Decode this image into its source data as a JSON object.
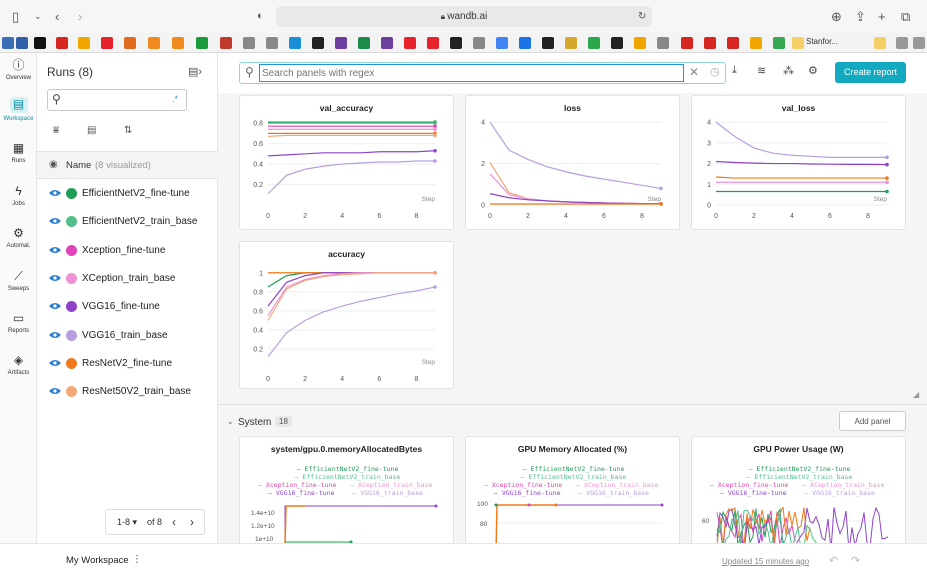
{
  "browser": {
    "url": "wandb.ai",
    "bookmark_label": "Stanfor..."
  },
  "rail": {
    "items": [
      {
        "label": "Overview",
        "icon": "info-icon"
      },
      {
        "label": "Workspace",
        "icon": "workspace-icon"
      },
      {
        "label": "Runs",
        "icon": "table-icon"
      },
      {
        "label": "Jobs",
        "icon": "lightning-icon"
      },
      {
        "label": "Automat.",
        "icon": "robot-icon"
      },
      {
        "label": "Sweeps",
        "icon": "broom-icon"
      },
      {
        "label": "Reports",
        "icon": "document-icon"
      },
      {
        "label": "Artifacts",
        "icon": "layers-icon"
      }
    ]
  },
  "runs_panel": {
    "title": "Runs (8)",
    "search_placeholder": "",
    "regex_symbol": ".*",
    "column_header": "Name",
    "column_header_sub": "(8 visualized)",
    "runs": [
      {
        "name": "EfficientNetV2_fine-tune",
        "color": "#1f9d55"
      },
      {
        "name": "EfficientNetV2_train_base",
        "color": "#52c08a"
      },
      {
        "name": "Xception_fine-tune",
        "color": "#e043b7"
      },
      {
        "name": "XCeption_train_base",
        "color": "#ef92d6"
      },
      {
        "name": "VGG16_fine-tune",
        "color": "#8e44c9"
      },
      {
        "name": "VGG16_train_base",
        "color": "#b79ee0"
      },
      {
        "name": "ResNetV2_fine-tune",
        "color": "#f07a1a"
      },
      {
        "name": "ResNet50V2_train_base",
        "color": "#f5a779"
      }
    ],
    "pager": {
      "range": "1-8",
      "of": "of 8"
    }
  },
  "toolbar": {
    "search_placeholder": "Search panels with regex",
    "create_report": "Create report"
  },
  "panels": {
    "val_accuracy": "val_accuracy",
    "loss": "loss",
    "val_loss": "val_loss",
    "accuracy": "accuracy",
    "step_label": "Step"
  },
  "system": {
    "label": "System",
    "count": "18",
    "add_panel": "Add panel",
    "panels": [
      {
        "title": "system/gpu.0.memoryAllocatedBytes",
        "ticks": [
          "1.4e+10",
          "1.2e+10",
          "1e+10"
        ]
      },
      {
        "title": "GPU Memory Allocated (%)",
        "ticks": [
          "100",
          "80"
        ]
      },
      {
        "title": "GPU Power Usage (W)",
        "ticks": [
          "60"
        ]
      }
    ],
    "legend": [
      "EfficientNetV2_fine-tune",
      "EfficientNetV2_train_base",
      "Xception_fine-tune",
      "XCeption_train_base",
      "VGG16_fine-tune",
      "VGG16_train_base"
    ]
  },
  "footer": {
    "workspace": "My Workspace",
    "updated": "Updated 15 minutes ago"
  },
  "chart_data": [
    {
      "type": "line",
      "title": "val_accuracy",
      "xlabel": "Step",
      "xlim": [
        0,
        9
      ],
      "ylim": [
        0,
        0.85
      ],
      "yticks": [
        0.8,
        0.6,
        0.4,
        0.2
      ],
      "xticks": [
        0,
        2,
        4,
        6,
        8
      ],
      "series": [
        {
          "name": "EfficientNetV2_fine-tune",
          "color": "#1f9d55",
          "x": [
            0,
            1,
            2,
            3,
            4,
            5,
            6,
            7,
            8,
            9
          ],
          "y": [
            0.81,
            0.81,
            0.81,
            0.81,
            0.81,
            0.81,
            0.81,
            0.81,
            0.81,
            0.81
          ]
        },
        {
          "name": "EfficientNetV2_train_base",
          "color": "#52c08a",
          "x": [
            0,
            1,
            2,
            3,
            4,
            5,
            6,
            7,
            8,
            9
          ],
          "y": [
            0.8,
            0.8,
            0.8,
            0.8,
            0.8,
            0.8,
            0.8,
            0.8,
            0.8,
            0.8
          ]
        },
        {
          "name": "Xception_fine-tune",
          "color": "#e043b7",
          "x": [
            0,
            1,
            2,
            3,
            4,
            5,
            6,
            7,
            8,
            9
          ],
          "y": [
            0.77,
            0.77,
            0.77,
            0.77,
            0.77,
            0.77,
            0.77,
            0.77,
            0.77,
            0.77
          ]
        },
        {
          "name": "XCeption_train_base",
          "color": "#ef92d6",
          "x": [
            0,
            1,
            2,
            3,
            4,
            5,
            6,
            7,
            8,
            9
          ],
          "y": [
            0.74,
            0.74,
            0.74,
            0.74,
            0.74,
            0.74,
            0.74,
            0.74,
            0.74,
            0.74
          ]
        },
        {
          "name": "ResNetV2_fine-tune",
          "color": "#f07a1a",
          "x": [
            0,
            1,
            2,
            3,
            4,
            5,
            6,
            7,
            8,
            9
          ],
          "y": [
            0.7,
            0.7,
            0.7,
            0.7,
            0.7,
            0.7,
            0.7,
            0.7,
            0.7,
            0.7
          ]
        },
        {
          "name": "ResNet50V2_train_base",
          "color": "#f5a779",
          "x": [
            0,
            1,
            2,
            3,
            4,
            5,
            6,
            7,
            8,
            9
          ],
          "y": [
            0.67,
            0.68,
            0.68,
            0.68,
            0.68,
            0.68,
            0.68,
            0.68,
            0.68,
            0.68
          ]
        },
        {
          "name": "VGG16_fine-tune",
          "color": "#8e44c9",
          "x": [
            0,
            1,
            2,
            3,
            4,
            5,
            6,
            7,
            8,
            9
          ],
          "y": [
            0.48,
            0.49,
            0.5,
            0.51,
            0.51,
            0.51,
            0.52,
            0.52,
            0.52,
            0.53
          ]
        },
        {
          "name": "VGG16_train_base",
          "color": "#b79ee0",
          "x": [
            0,
            1,
            2,
            3,
            4,
            5,
            6,
            7,
            8,
            9
          ],
          "y": [
            0.11,
            0.29,
            0.35,
            0.38,
            0.4,
            0.41,
            0.42,
            0.42,
            0.43,
            0.43
          ]
        }
      ]
    },
    {
      "type": "line",
      "title": "loss",
      "xlabel": "Step",
      "xlim": [
        0,
        9
      ],
      "ylim": [
        0,
        4.2
      ],
      "yticks": [
        4,
        2,
        0
      ],
      "xticks": [
        0,
        2,
        4,
        6,
        8
      ],
      "series": [
        {
          "name": "VGG16_train_base",
          "color": "#b79ee0",
          "x": [
            0,
            1,
            2,
            3,
            4,
            5,
            6,
            7,
            8,
            9
          ],
          "y": [
            4.0,
            2.65,
            2.2,
            1.85,
            1.6,
            1.4,
            1.25,
            1.1,
            0.95,
            0.8
          ]
        },
        {
          "name": "ResNet50V2_train_base",
          "color": "#f5a779",
          "x": [
            0,
            1,
            2,
            3,
            4,
            5,
            6,
            7,
            8,
            9
          ],
          "y": [
            2.05,
            0.6,
            0.3,
            0.2,
            0.15,
            0.12,
            0.1,
            0.08,
            0.07,
            0.06
          ]
        },
        {
          "name": "XCeption_train_base",
          "color": "#ef92d6",
          "x": [
            0,
            1,
            2,
            3,
            4,
            5,
            6,
            7,
            8,
            9
          ],
          "y": [
            1.5,
            0.5,
            0.3,
            0.2,
            0.15,
            0.12,
            0.1,
            0.08,
            0.07,
            0.06
          ]
        },
        {
          "name": "VGG16_fine-tune",
          "color": "#8e44c9",
          "x": [
            0,
            1,
            2,
            3,
            4,
            5,
            6,
            7,
            8,
            9
          ],
          "y": [
            0.55,
            0.35,
            0.25,
            0.2,
            0.15,
            0.12,
            0.1,
            0.08,
            0.07,
            0.06
          ]
        },
        {
          "name": "ResNetV2_fine-tune",
          "color": "#f07a1a",
          "x": [
            0,
            1,
            2,
            3,
            4,
            5,
            6,
            7,
            8,
            9
          ],
          "y": [
            0.05,
            0.05,
            0.05,
            0.05,
            0.05,
            0.05,
            0.05,
            0.05,
            0.05,
            0.05
          ]
        }
      ]
    },
    {
      "type": "line",
      "title": "val_loss",
      "xlabel": "Step",
      "xlim": [
        0,
        9
      ],
      "ylim": [
        0,
        4.2
      ],
      "yticks": [
        4,
        3,
        2,
        1,
        0
      ],
      "xticks": [
        0,
        2,
        4,
        6,
        8
      ],
      "series": [
        {
          "name": "VGG16_train_base",
          "color": "#b79ee0",
          "x": [
            0,
            1,
            2,
            3,
            4,
            5,
            6,
            7,
            8,
            9
          ],
          "y": [
            4.0,
            3.3,
            2.75,
            2.5,
            2.4,
            2.35,
            2.3,
            2.3,
            2.3,
            2.3
          ]
        },
        {
          "name": "VGG16_fine-tune",
          "color": "#8e44c9",
          "x": [
            0,
            1,
            2,
            3,
            4,
            5,
            6,
            7,
            8,
            9
          ],
          "y": [
            2.1,
            2.05,
            2.02,
            2.0,
            2.0,
            1.98,
            1.97,
            1.96,
            1.96,
            1.95
          ]
        },
        {
          "name": "ResNetV2_fine-tune",
          "color": "#f07a1a",
          "x": [
            0,
            1,
            2,
            3,
            4,
            5,
            6,
            7,
            8,
            9
          ],
          "y": [
            1.35,
            1.3,
            1.3,
            1.3,
            1.3,
            1.3,
            1.3,
            1.3,
            1.3,
            1.3
          ]
        },
        {
          "name": "XCeption_train_base",
          "color": "#ef92d6",
          "x": [
            0,
            1,
            2,
            3,
            4,
            5,
            6,
            7,
            8,
            9
          ],
          "y": [
            1.1,
            1.1,
            1.1,
            1.1,
            1.1,
            1.1,
            1.1,
            1.1,
            1.1,
            1.1
          ]
        },
        {
          "name": "EfficientNetV2_fine-tune",
          "color": "#1f9d55",
          "x": [
            0,
            1,
            2,
            3,
            4,
            5,
            6,
            7,
            8,
            9
          ],
          "y": [
            0.65,
            0.65,
            0.65,
            0.65,
            0.65,
            0.65,
            0.65,
            0.65,
            0.65,
            0.65
          ]
        }
      ]
    },
    {
      "type": "line",
      "title": "accuracy",
      "xlabel": "Step",
      "xlim": [
        0,
        9
      ],
      "ylim": [
        0,
        1.05
      ],
      "yticks": [
        1,
        0.8,
        0.6,
        0.4,
        0.2
      ],
      "xticks": [
        0,
        2,
        4,
        6,
        8
      ],
      "series": [
        {
          "name": "EfficientNetV2_fine-tune",
          "color": "#1f9d55",
          "x": [
            0,
            1,
            2,
            3,
            4,
            5,
            6,
            7,
            8,
            9
          ],
          "y": [
            0.85,
            0.97,
            1.0,
            1.0,
            1.0,
            1.0,
            1.0,
            1.0,
            1.0,
            1.0
          ]
        },
        {
          "name": "ResNetV2_fine-tune",
          "color": "#f07a1a",
          "x": [
            0,
            1,
            2,
            3,
            4,
            5,
            6,
            7,
            8,
            9
          ],
          "y": [
            1.0,
            1.0,
            1.0,
            1.0,
            1.0,
            1.0,
            1.0,
            1.0,
            1.0,
            1.0
          ]
        },
        {
          "name": "VGG16_fine-tune",
          "color": "#8e44c9",
          "x": [
            0,
            1,
            2,
            3,
            4,
            5,
            6,
            7,
            8,
            9
          ],
          "y": [
            0.65,
            0.9,
            0.97,
            1.0,
            1.0,
            1.0,
            1.0,
            1.0,
            1.0,
            1.0
          ]
        },
        {
          "name": "XCeption_train_base",
          "color": "#ef92d6",
          "x": [
            0,
            1,
            2,
            3,
            4,
            5,
            6,
            7,
            8,
            9
          ],
          "y": [
            0.55,
            0.85,
            0.93,
            0.97,
            0.99,
            1.0,
            1.0,
            1.0,
            1.0,
            1.0
          ]
        },
        {
          "name": "ResNet50V2_train_base",
          "color": "#f5a779",
          "x": [
            0,
            1,
            2,
            3,
            4,
            5,
            6,
            7,
            8,
            9
          ],
          "y": [
            0.5,
            0.83,
            0.92,
            0.96,
            0.98,
            0.99,
            1.0,
            1.0,
            1.0,
            1.0
          ]
        },
        {
          "name": "VGG16_train_base",
          "color": "#b79ee0",
          "x": [
            0,
            1,
            2,
            3,
            4,
            5,
            6,
            7,
            8,
            9
          ],
          "y": [
            0.12,
            0.37,
            0.5,
            0.59,
            0.65,
            0.7,
            0.74,
            0.78,
            0.81,
            0.85
          ]
        }
      ]
    }
  ]
}
